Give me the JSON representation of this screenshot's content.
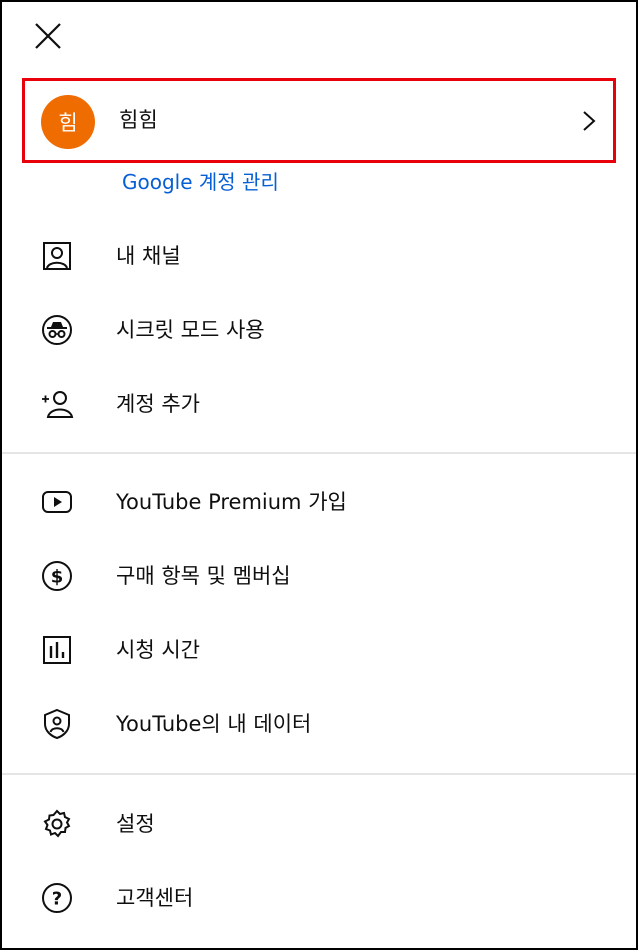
{
  "header": {
    "close_icon": "close-icon"
  },
  "account": {
    "avatar_initial": "힘",
    "avatar_color": "#ef6c00",
    "name": "힘힘",
    "manage_link": "Google 계정 관리",
    "highlight_color": "#e8000b"
  },
  "section1": {
    "items": [
      {
        "label": "내 채널",
        "icon": "person-box-icon"
      },
      {
        "label": "시크릿 모드 사용",
        "icon": "incognito-icon"
      },
      {
        "label": "계정 추가",
        "icon": "add-account-icon"
      }
    ]
  },
  "section2": {
    "items": [
      {
        "label": "YouTube Premium 가입",
        "icon": "youtube-play-icon"
      },
      {
        "label": "구매 항목 및 멤버십",
        "icon": "dollar-circle-icon"
      },
      {
        "label": "시청 시간",
        "icon": "bar-chart-icon"
      },
      {
        "label": "YouTube의 내 데이터",
        "icon": "shield-user-icon"
      }
    ]
  },
  "section3": {
    "items": [
      {
        "label": "설정",
        "icon": "gear-icon"
      },
      {
        "label": "고객센터",
        "icon": "help-circle-icon"
      }
    ]
  },
  "colors": {
    "link": "#065fd4",
    "divider": "#e5e5e5",
    "text": "#0f0f0f"
  }
}
